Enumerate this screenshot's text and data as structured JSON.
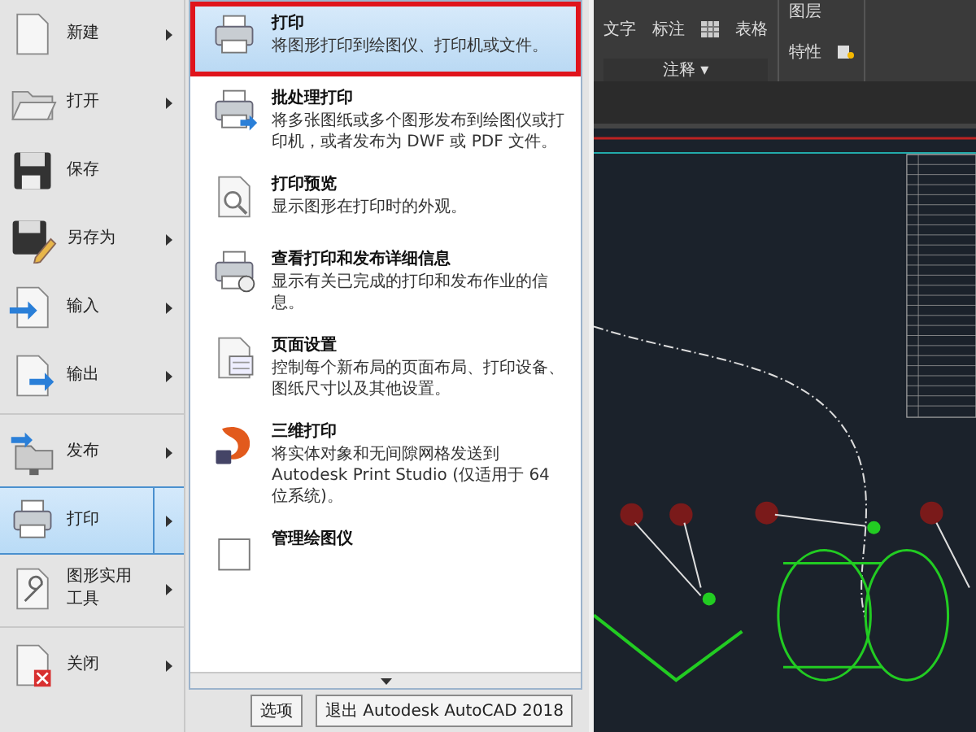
{
  "app_menu": {
    "items": [
      {
        "label": "新建",
        "has_submenu": true,
        "selected": false,
        "divider_after": false
      },
      {
        "label": "打开",
        "has_submenu": true,
        "selected": false,
        "divider_after": false
      },
      {
        "label": "保存",
        "has_submenu": false,
        "selected": false,
        "divider_after": false
      },
      {
        "label": "另存为",
        "has_submenu": true,
        "selected": false,
        "divider_after": false
      },
      {
        "label": "输入",
        "has_submenu": true,
        "selected": false,
        "divider_after": false
      },
      {
        "label": "输出",
        "has_submenu": true,
        "selected": false,
        "divider_after": true
      },
      {
        "label": "发布",
        "has_submenu": true,
        "selected": false,
        "divider_after": false
      },
      {
        "label": "打印",
        "has_submenu": true,
        "selected": true,
        "divider_after": false
      },
      {
        "label": "图形实用工具",
        "has_submenu": true,
        "selected": false,
        "divider_after": true
      },
      {
        "label": "关闭",
        "has_submenu": true,
        "selected": false,
        "divider_after": false
      }
    ]
  },
  "print_submenu": {
    "items": [
      {
        "title": "打印",
        "description": "将图形打印到绘图仪、打印机或文件。",
        "selected": true,
        "highlighted_frame": true
      },
      {
        "title": "批处理打印",
        "description": "将多张图纸或多个图形发布到绘图仪或打印机，或者发布为 DWF 或 PDF 文件。",
        "selected": false,
        "highlighted_frame": false
      },
      {
        "title": "打印预览",
        "description": "显示图形在打印时的外观。",
        "selected": false,
        "highlighted_frame": false
      },
      {
        "title": "查看打印和发布详细信息",
        "description": "显示有关已完成的打印和发布作业的信息。",
        "selected": false,
        "highlighted_frame": false
      },
      {
        "title": "页面设置",
        "description": "控制每个新布局的页面布局、打印设备、图纸尺寸以及其他设置。",
        "selected": false,
        "highlighted_frame": false
      },
      {
        "title": "三维打印",
        "description": "将实体对象和无间隙网格发送到 Autodesk Print Studio (仅适用于 64 位系统)。",
        "selected": false,
        "highlighted_frame": false
      },
      {
        "title": "管理绘图仪",
        "selected": false,
        "highlighted_frame": false
      }
    ]
  },
  "footer_buttons": [
    "选项",
    "退出 Autodesk AutoCAD 2018"
  ],
  "ribbon": {
    "annotation": {
      "text": "文字",
      "dimension": "标注",
      "table": "表格",
      "title": "注释",
      "title_caret": "▾"
    },
    "layers": {
      "label_1": "图层",
      "label_2": "特性"
    }
  }
}
